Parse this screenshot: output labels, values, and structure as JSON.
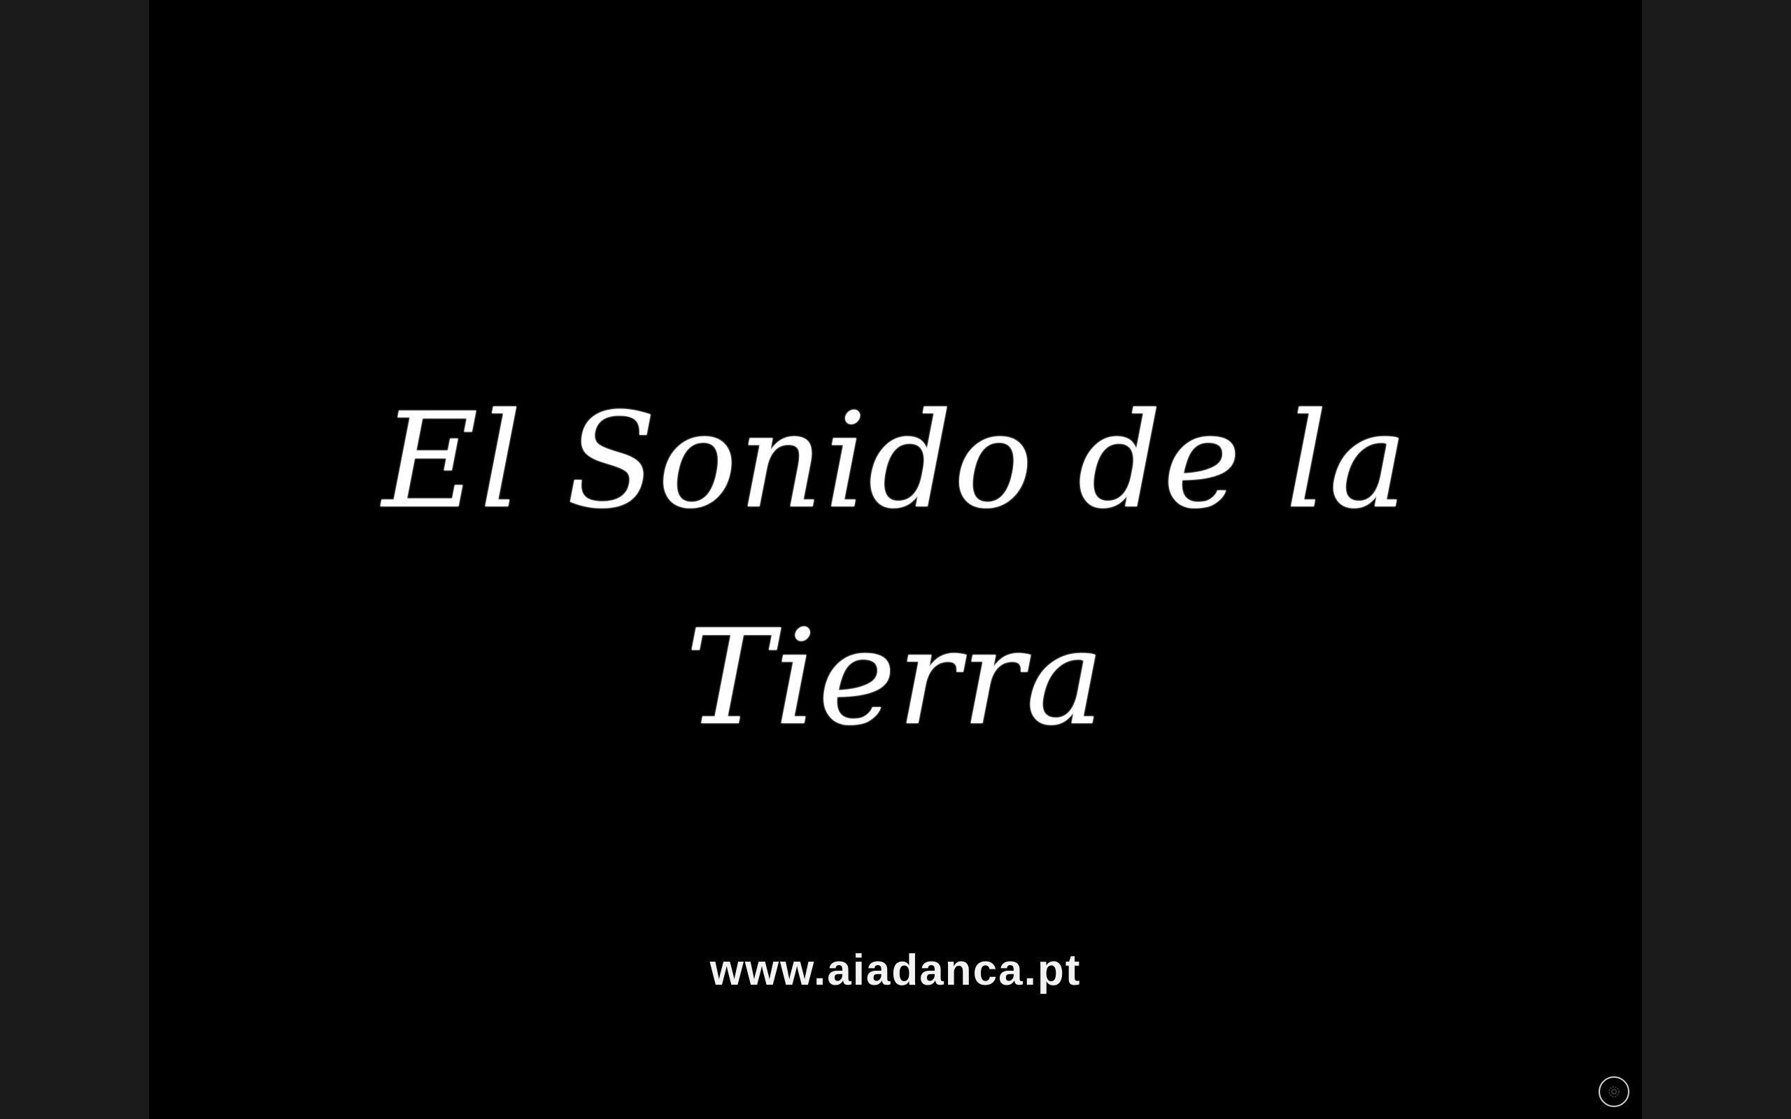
{
  "slide": {
    "title_lines": [
      "El Sonido de la",
      "Tierra"
    ],
    "url": "www.aiadanca.pt"
  },
  "controls": {
    "corner_button_icon": "settings-icon"
  },
  "colors": {
    "page_background": "#1b1b1b",
    "slide_background": "#000000",
    "text": "#ffffff"
  }
}
